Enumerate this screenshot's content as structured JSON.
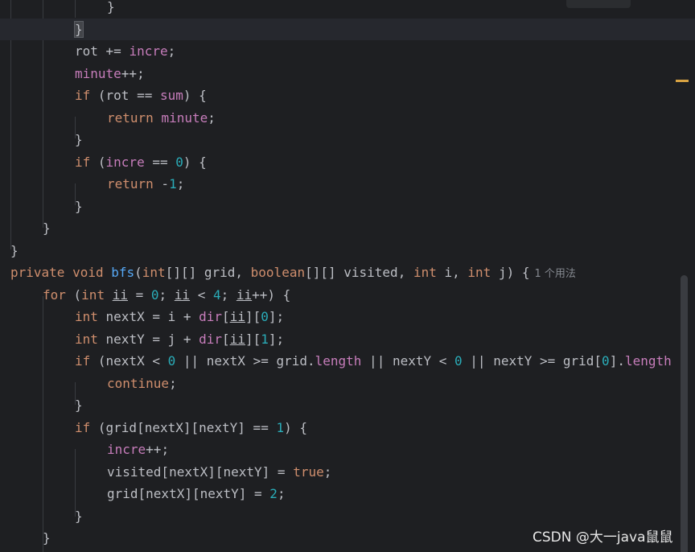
{
  "editor": {
    "inlay_hint": "1 个用法",
    "watermark": "CSDN @大一java鼠鼠"
  },
  "lines": [
    [
      [
        "p",
        "}"
      ]
    ],
    [
      [
        "p",
        "}"
      ]
    ],
    [
      [
        "p",
        "rot += "
      ],
      [
        "f",
        "incre"
      ],
      [
        "p",
        ";"
      ]
    ],
    [
      [
        "f",
        "minute"
      ],
      [
        "p",
        "++;"
      ]
    ],
    [
      [
        "k",
        "if"
      ],
      [
        "p",
        " (rot == "
      ],
      [
        "f",
        "sum"
      ],
      [
        "p",
        ") {"
      ]
    ],
    [
      [
        "k",
        "return"
      ],
      [
        "p",
        " "
      ],
      [
        "f",
        "minute"
      ],
      [
        "p",
        ";"
      ]
    ],
    [
      [
        "p",
        "}"
      ]
    ],
    [
      [
        "k",
        "if"
      ],
      [
        "p",
        " ("
      ],
      [
        "f",
        "incre"
      ],
      [
        "p",
        " == "
      ],
      [
        "n",
        "0"
      ],
      [
        "p",
        ") {"
      ]
    ],
    [
      [
        "k",
        "return"
      ],
      [
        "p",
        " -"
      ],
      [
        "n",
        "1"
      ],
      [
        "p",
        ";"
      ]
    ],
    [
      [
        "p",
        "}"
      ]
    ],
    [
      [
        "p",
        "}"
      ]
    ],
    [
      [
        "p",
        "}"
      ]
    ],
    [
      [
        "k",
        "private void "
      ],
      [
        "m",
        "bfs"
      ],
      [
        "p",
        "("
      ],
      [
        "k",
        "int"
      ],
      [
        "p",
        "[][] grid, "
      ],
      [
        "k",
        "boolean"
      ],
      [
        "p",
        "[][] visited, "
      ],
      [
        "k",
        "int"
      ],
      [
        "p",
        " i, "
      ],
      [
        "k",
        "int"
      ],
      [
        "p",
        " j) {"
      ]
    ],
    [
      [
        "k",
        "for"
      ],
      [
        "p",
        " ("
      ],
      [
        "k",
        "int"
      ],
      [
        "p",
        " "
      ],
      [
        "u",
        "ii"
      ],
      [
        "p",
        " = "
      ],
      [
        "n",
        "0"
      ],
      [
        "p",
        "; "
      ],
      [
        "u",
        "ii"
      ],
      [
        "p",
        " < "
      ],
      [
        "n",
        "4"
      ],
      [
        "p",
        "; "
      ],
      [
        "u",
        "ii"
      ],
      [
        "p",
        "++) {"
      ]
    ],
    [
      [
        "k",
        "int"
      ],
      [
        "p",
        " nextX = i + "
      ],
      [
        "f",
        "dir"
      ],
      [
        "p",
        "["
      ],
      [
        "u",
        "ii"
      ],
      [
        "p",
        "]["
      ],
      [
        "n",
        "0"
      ],
      [
        "p",
        "];"
      ]
    ],
    [
      [
        "k",
        "int"
      ],
      [
        "p",
        " nextY = j + "
      ],
      [
        "f",
        "dir"
      ],
      [
        "p",
        "["
      ],
      [
        "u",
        "ii"
      ],
      [
        "p",
        "]["
      ],
      [
        "n",
        "1"
      ],
      [
        "p",
        "];"
      ]
    ],
    [
      [
        "k",
        "if"
      ],
      [
        "p",
        " (nextX < "
      ],
      [
        "n",
        "0"
      ],
      [
        "p",
        " || nextX >= grid."
      ],
      [
        "f",
        "length"
      ],
      [
        "p",
        " || nextY < "
      ],
      [
        "n",
        "0"
      ],
      [
        "p",
        " || nextY >= grid["
      ],
      [
        "n",
        "0"
      ],
      [
        "p",
        "]."
      ],
      [
        "f",
        "length"
      ]
    ],
    [
      [
        "k",
        "continue"
      ],
      [
        "p",
        ";"
      ]
    ],
    [
      [
        "p",
        "}"
      ]
    ],
    [
      [
        "k",
        "if"
      ],
      [
        "p",
        " (grid[nextX][nextY] == "
      ],
      [
        "n",
        "1"
      ],
      [
        "p",
        ") {"
      ]
    ],
    [
      [
        "f",
        "incre"
      ],
      [
        "p",
        "++;"
      ]
    ],
    [
      [
        "p",
        "visited[nextX][nextY] = "
      ],
      [
        "k",
        "true"
      ],
      [
        "p",
        ";"
      ]
    ],
    [
      [
        "p",
        "grid[nextX][nextY] = "
      ],
      [
        "n",
        "2"
      ],
      [
        "p",
        ";"
      ]
    ],
    [
      [
        "p",
        "}"
      ]
    ],
    [
      [
        "p",
        "}"
      ]
    ]
  ]
}
